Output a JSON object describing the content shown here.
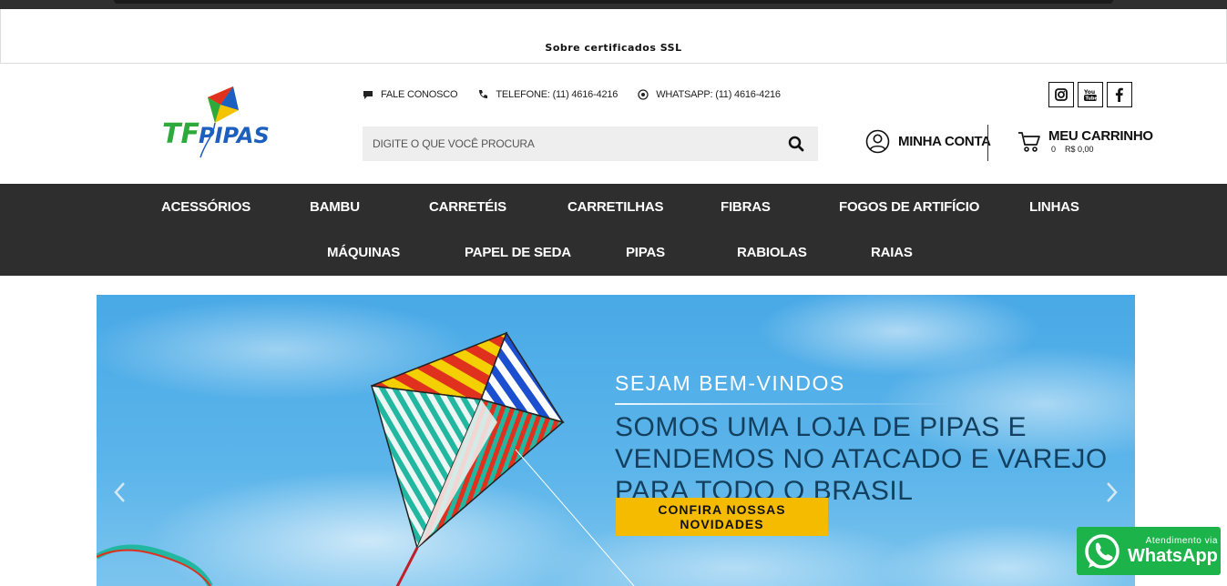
{
  "ssl": {
    "label": "Sobre certificados SSL"
  },
  "brand": {
    "name": "TF PIPAS",
    "colors": {
      "green": "#2eaa3c",
      "blue": "#1d5fbf",
      "yellow": "#f5c400",
      "red": "#e0301e"
    }
  },
  "contacts": {
    "fale": "FALE CONOSCO",
    "telefone": "TELEFONE: (11) 4616-4216",
    "whatsapp": "WHATSAPP: (11) 4616-4216"
  },
  "search": {
    "placeholder": "DIGITE O QUE VOCÊ PROCURA"
  },
  "social": [
    "instagram-icon",
    "youtube-icon",
    "facebook-icon"
  ],
  "account": {
    "label": "MINHA CONTA"
  },
  "cart": {
    "label": "MEU CARRINHO",
    "count": "0",
    "total": "R$ 0,00"
  },
  "nav": {
    "row1": [
      "ACESSÓRIOS",
      "BAMBU",
      "CARRETÉIS",
      "CARRETILHAS",
      "FIBRAS",
      "FOGOS DE ARTIFÍCIO",
      "LINHAS"
    ],
    "row2": [
      "MÁQUINAS",
      "PAPEL DE SEDA",
      "PIPAS",
      "RABIOLAS",
      "RAIAS"
    ]
  },
  "hero": {
    "welcome": "SEJAM BEM-VINDOS",
    "headline": "SOMOS UMA LOJA DE PIPAS E VENDEMOS NO ATACADO E VAREJO PARA TODO O BRASIL",
    "cta": "CONFIRA NOSSAS NOVIDADES",
    "accent": "#f5bb00"
  },
  "whatsapp_widget": {
    "small": "Atendimento via",
    "big": "WhatsApp"
  }
}
